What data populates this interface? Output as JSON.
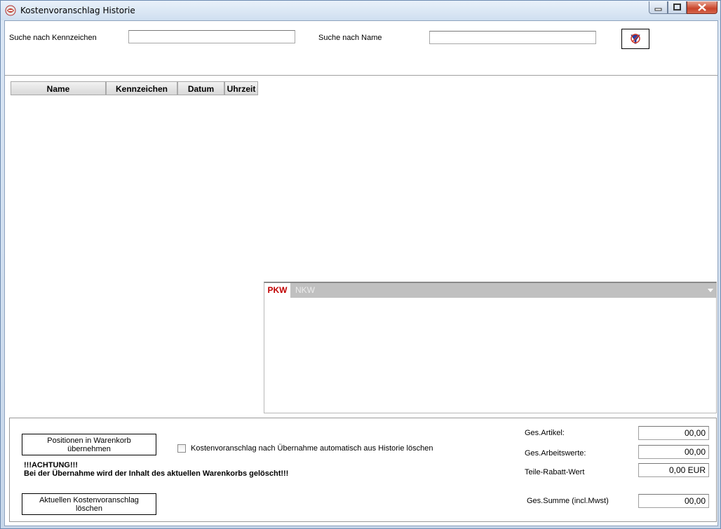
{
  "window": {
    "title": "Kostenvoranschlag Historie"
  },
  "search": {
    "kennzeichen_label": "Suche nach Kennzeichen",
    "kennzeichen_value": "",
    "name_label": "Suche nach Name",
    "name_value": ""
  },
  "history_table": {
    "columns": [
      "Name",
      "Kennzeichen",
      "Datum",
      "Uhrzeit"
    ],
    "rows": []
  },
  "detail_tabs": {
    "tabs": [
      "PKW",
      "NKW"
    ],
    "active": "PKW"
  },
  "actions": {
    "transfer_button_line1": "Positionen in Warenkorb",
    "transfer_button_line2": "übernehmen",
    "auto_delete_label": "Kostenvoranschlag nach Übernahme automatisch aus Historie löschen",
    "auto_delete_checked": false,
    "warning_line1": "!!!ACHTUNG!!!",
    "warning_line2": "Bei der Übernahme wird der Inhalt des aktuellen Warenkorbs gelöscht!!!",
    "delete_button_line1": "Aktuellen Kostenvoranschlag",
    "delete_button_line2": "löschen"
  },
  "summary": {
    "ges_artikel_label": "Ges.Artikel:",
    "ges_artikel_value": "00,00",
    "ges_arbeitswerte_label": "Ges.Arbeitswerte:",
    "ges_arbeitswerte_value": "00,00",
    "teile_rabatt_label": "Teile-Rabatt-Wert",
    "teile_rabatt_value": "0,00 EUR",
    "ges_summe_label": "Ges.Summe (incl.Mwst)",
    "ges_summe_value": "00,00"
  },
  "colors": {
    "active_tab_text": "#c00000",
    "tabstrip_bg": "#c0c0c0",
    "close_button": "#c9442a"
  },
  "icons": {
    "app": "app-logo-icon",
    "filter": "filter-clear-icon",
    "minimize": "minimize-icon",
    "maximize": "maximize-icon",
    "close": "close-icon"
  }
}
